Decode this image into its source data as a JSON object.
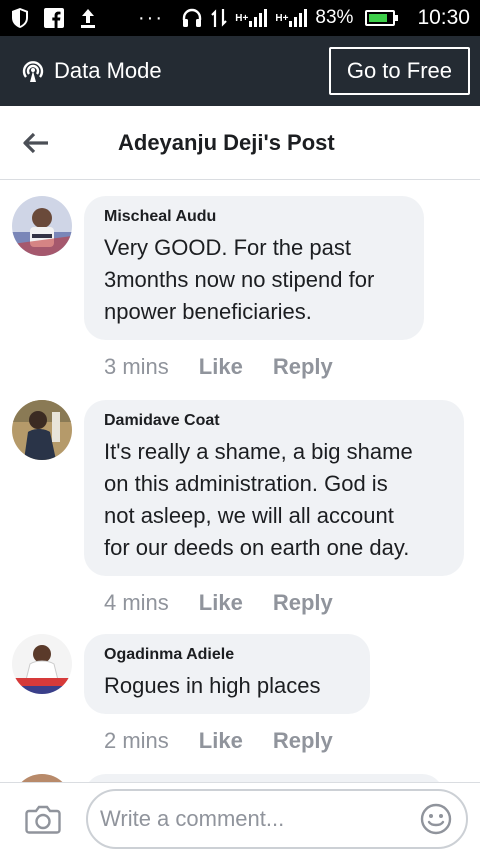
{
  "status_bar": {
    "battery_percent": "83%",
    "battery_level": 0.83,
    "time": "10:30",
    "dots": "···",
    "net_a": "H+",
    "net_b": "H+"
  },
  "data_mode": {
    "label": "Data Mode",
    "button": "Go to Free"
  },
  "header": {
    "title": "Adeyanju Deji's Post"
  },
  "comments": [
    {
      "name": "Mischeal Audu",
      "text_lines": [
        "Very GOOD. For the past",
        "3months now no stipend for",
        "npower beneficiaries."
      ],
      "time": "3 mins",
      "like": "Like",
      "reply": "Reply"
    },
    {
      "name": "Damidave Coat",
      "text_lines": [
        "It's really a shame, a big shame",
        "on this administration. God is",
        "not asleep, we will all account",
        "for our deeds on earth one day."
      ],
      "time": "4 mins",
      "like": "Like",
      "reply": "Reply"
    },
    {
      "name": "Ogadinma Adiele",
      "text_lines": [
        "Rogues in high places"
      ],
      "time": "2 mins",
      "like": "Like",
      "reply": "Reply"
    }
  ],
  "composer": {
    "placeholder": "Write a comment..."
  },
  "colors": {
    "status_bar_bg": "#000000",
    "data_mode_bg": "#242b33",
    "bubble_bg": "#f0f2f5",
    "meta_text": "#90949c",
    "battery_fill": "#3ecf4a"
  }
}
